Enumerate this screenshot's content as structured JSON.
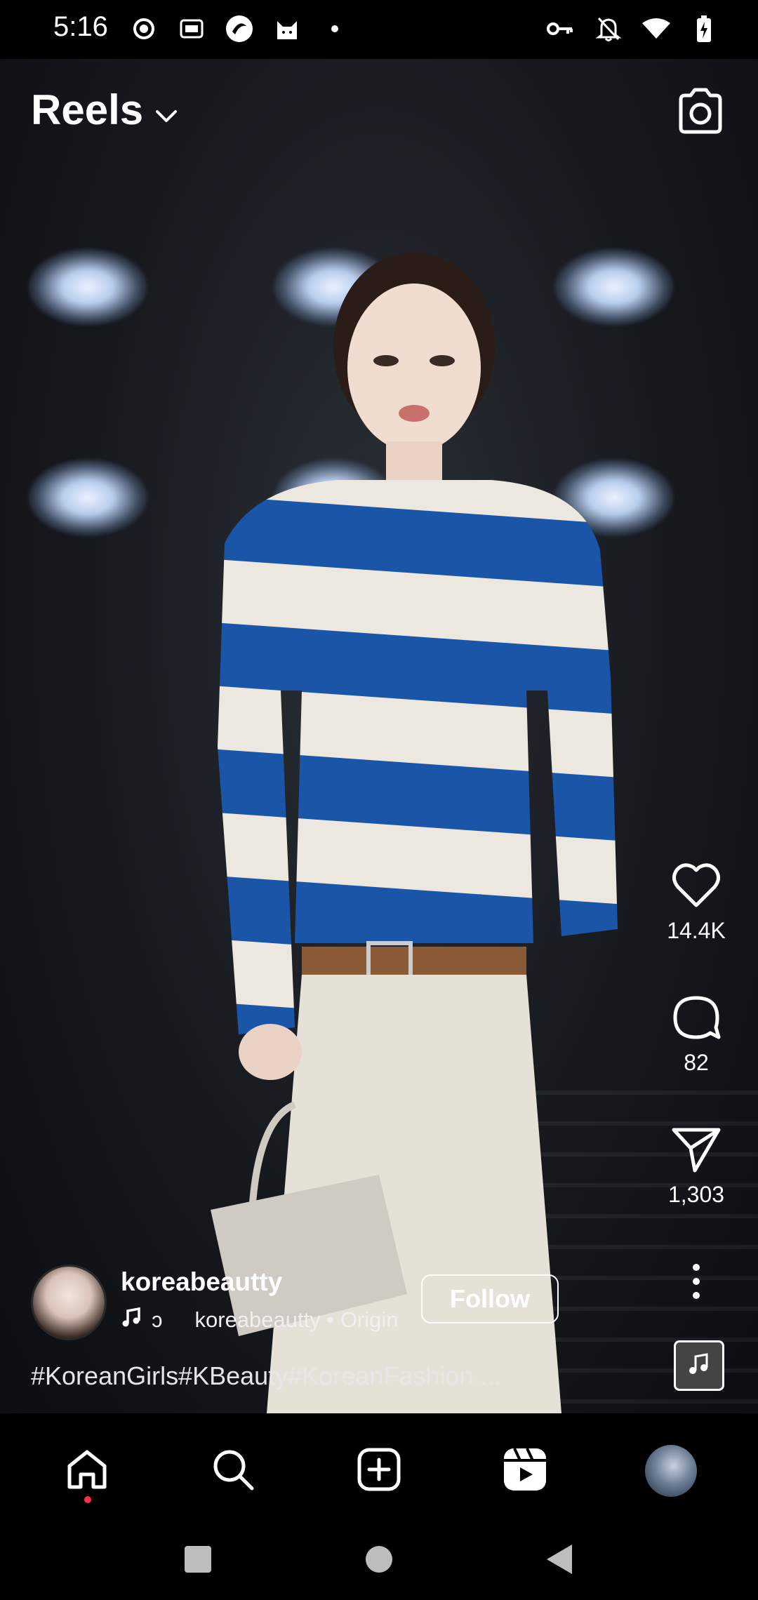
{
  "status_bar": {
    "time": "5:16",
    "left_icons": [
      "record-icon",
      "iqiyi-icon",
      "app-logo-icon",
      "cat-app-icon",
      "dot-icon"
    ],
    "right_icons": [
      "key-icon",
      "bell-muted-icon",
      "wifi-icon",
      "battery-charging-icon"
    ]
  },
  "header": {
    "title": "Reels",
    "dropdown_icon": "chevron-down-icon",
    "camera_icon": "camera-icon"
  },
  "actions": {
    "like_count": "14.4K",
    "comment_count": "82",
    "share_count": "1,303"
  },
  "post": {
    "username": "koreabeautty",
    "audio_prefix": "ɔ",
    "audio_text": "koreabeautty • Origin",
    "follow_label": "Follow",
    "caption": "#KoreanGirls#KBeauty#KoreanFashion ..."
  },
  "bottom_nav": [
    "home-icon",
    "search-icon",
    "create-icon",
    "reels-icon",
    "profile-avatar"
  ],
  "colors": {
    "background": "#000000",
    "text": "#ffffff",
    "notification_dot": "#ff3040"
  }
}
